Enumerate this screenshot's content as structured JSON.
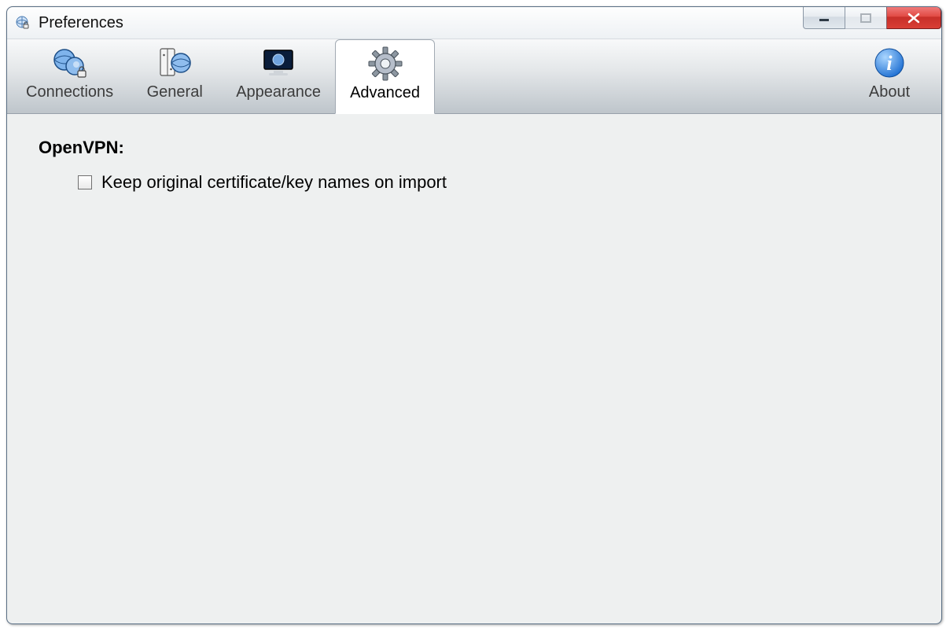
{
  "window": {
    "title": "Preferences"
  },
  "toolbar": {
    "items": [
      {
        "label": "Connections",
        "icon": "globe-lock-icon",
        "active": false
      },
      {
        "label": "General",
        "icon": "panel-globe-icon",
        "active": false
      },
      {
        "label": "Appearance",
        "icon": "monitor-icon",
        "active": false
      },
      {
        "label": "Advanced",
        "icon": "gear-icon",
        "active": true
      }
    ],
    "about": {
      "label": "About",
      "icon": "info-icon"
    }
  },
  "content": {
    "section_title": "OpenVPN:",
    "options": [
      {
        "label": "Keep original certificate/key names on import",
        "checked": false
      }
    ]
  },
  "colors": {
    "accent_blue": "#2a7bd6",
    "close_red": "#d93e35",
    "toolbar_text": "#3c3c3c"
  }
}
